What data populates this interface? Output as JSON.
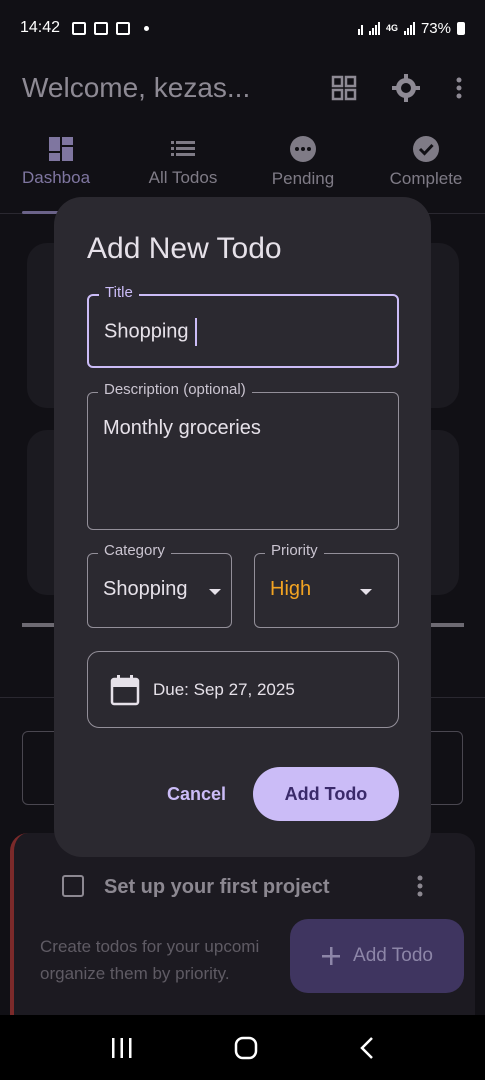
{
  "status_bar": {
    "time": "14:42",
    "network": "4G",
    "battery": "73%"
  },
  "app_bar": {
    "title": "Welcome, kezas...",
    "icons": [
      "grid-icon",
      "settings-icon",
      "more-vert-icon"
    ]
  },
  "tabs": [
    {
      "label": "Dashboa",
      "icon": "dashboard-icon",
      "active": true
    },
    {
      "label": "All Todos",
      "icon": "list-icon",
      "active": false
    },
    {
      "label": "Pending",
      "icon": "pending-icon",
      "active": false
    },
    {
      "label": "Complete",
      "icon": "check-circle-icon",
      "active": false
    }
  ],
  "background_todo": {
    "title": "Set up your first project",
    "description_lines": [
      "Create todos for your upcomi",
      "organize them by priority."
    ]
  },
  "fab": {
    "label": "Add Todo",
    "icon": "plus-icon"
  },
  "dialog": {
    "title": "Add New Todo",
    "title_field": {
      "label": "Title",
      "value": "Shopping"
    },
    "description_field": {
      "label": "Description (optional)",
      "value": "Monthly groceries"
    },
    "category_field": {
      "label": "Category",
      "value": "Shopping"
    },
    "priority_field": {
      "label": "Priority",
      "value": "High",
      "value_color": "#f2a322"
    },
    "due_date": {
      "label": "Due: Sep 27, 2025",
      "icon": "calendar-icon"
    },
    "cancel_label": "Cancel",
    "submit_label": "Add Todo"
  },
  "colors": {
    "accent": "#cbbcf7",
    "dialog_bg": "#2b2930",
    "priority_high": "#f2a322"
  }
}
